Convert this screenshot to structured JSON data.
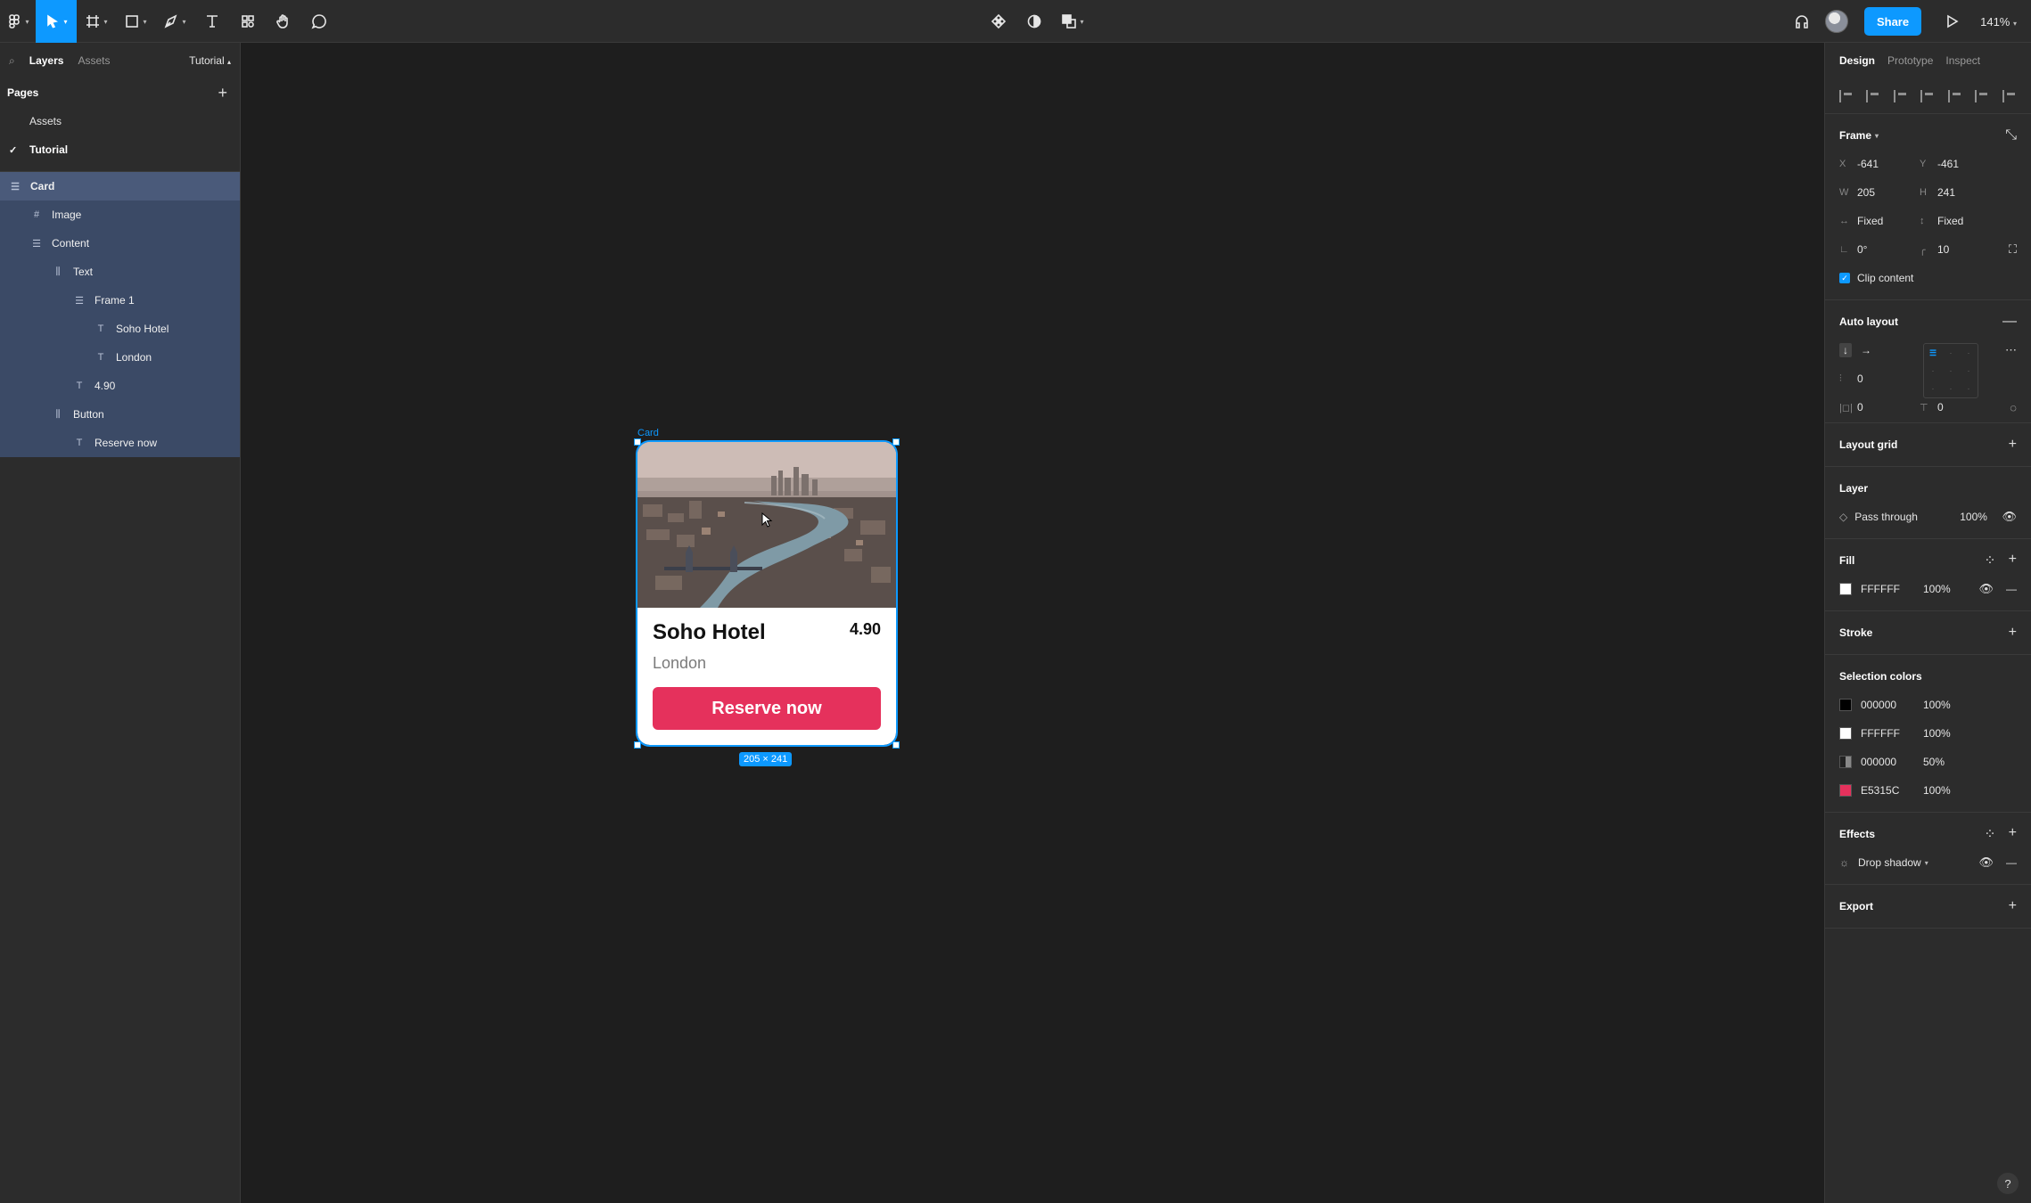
{
  "toolbar": {
    "share_label": "Share",
    "zoom": "141%",
    "icons": [
      "figma-menu-icon",
      "move-tool-icon",
      "frame-tool-icon",
      "shape-tool-icon",
      "pen-tool-icon",
      "text-tool-icon",
      "resources-icon",
      "hand-tool-icon",
      "comment-icon",
      "component-icon",
      "contrast-icon",
      "boolean-ops-icon",
      "headphones-icon",
      "present-icon"
    ]
  },
  "left_panel": {
    "tabs": {
      "layers": "Layers",
      "assets": "Assets",
      "page": "Tutorial"
    },
    "pages_title": "Pages",
    "pages": [
      {
        "label": "Assets",
        "selected": false
      },
      {
        "label": "Tutorial",
        "selected": true
      }
    ],
    "layers": [
      {
        "label": "Card",
        "icon": "auto-layout-icon",
        "indent": 0
      },
      {
        "label": "Image",
        "icon": "frame-icon",
        "indent": 1
      },
      {
        "label": "Content",
        "icon": "auto-layout-icon",
        "indent": 1
      },
      {
        "label": "Text",
        "icon": "auto-layout-horizontal-icon",
        "indent": 2
      },
      {
        "label": "Frame 1",
        "icon": "auto-layout-icon",
        "indent": 3
      },
      {
        "label": "Soho Hotel",
        "icon": "text-icon",
        "indent": 4
      },
      {
        "label": "London",
        "icon": "text-icon",
        "indent": 4
      },
      {
        "label": "4.90",
        "icon": "text-icon",
        "indent": 3
      },
      {
        "label": "Button",
        "icon": "auto-layout-horizontal-icon",
        "indent": 2
      },
      {
        "label": "Reserve now",
        "icon": "text-icon",
        "indent": 3
      }
    ]
  },
  "canvas": {
    "frame_label": "Card",
    "card": {
      "title": "Soho Hotel",
      "rating": "4.90",
      "location": "London",
      "button_label": "Reserve now"
    },
    "size_badge": "205 × 241"
  },
  "right_panel": {
    "tabs": {
      "design": "Design",
      "prototype": "Prototype",
      "inspect": "Inspect"
    },
    "frame": {
      "title": "Frame",
      "x": "-641",
      "y": "-461",
      "w": "205",
      "h": "241",
      "x_label": "X",
      "y_label": "Y",
      "w_label": "W",
      "h_label": "H",
      "h_sizing": "Fixed",
      "v_sizing": "Fixed",
      "rotation": "0°",
      "radius": "10",
      "clip_content": "Clip content"
    },
    "auto_layout": {
      "title": "Auto layout",
      "spacing": "0",
      "padding_h": "0",
      "padding_v": "0"
    },
    "layout_grid": {
      "title": "Layout grid"
    },
    "layer": {
      "title": "Layer",
      "blend": "Pass through",
      "opacity": "100%"
    },
    "fill": {
      "title": "Fill",
      "hex": "FFFFFF",
      "opacity": "100%"
    },
    "stroke": {
      "title": "Stroke"
    },
    "selection_colors": {
      "title": "Selection colors",
      "items": [
        {
          "hex": "000000",
          "opacity": "100%",
          "color": "#000000"
        },
        {
          "hex": "FFFFFF",
          "opacity": "100%",
          "color": "#FFFFFF"
        },
        {
          "hex": "000000",
          "opacity": "50%",
          "color": "#808080"
        },
        {
          "hex": "E5315C",
          "opacity": "100%",
          "color": "#E5315C"
        }
      ]
    },
    "effects": {
      "title": "Effects",
      "item": "Drop shadow"
    },
    "export": {
      "title": "Export"
    },
    "help": "?"
  },
  "colors": {
    "accent": "#0d99ff",
    "brand_button": "#e5315c",
    "canvas": "#1e1e1e",
    "panel": "#2c2c2c"
  }
}
